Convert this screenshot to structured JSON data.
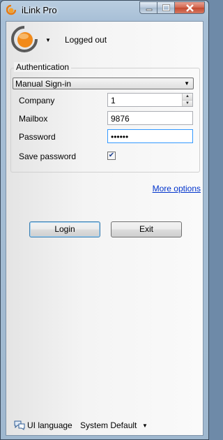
{
  "window": {
    "title": "iLink Pro"
  },
  "status": {
    "text": "Logged out",
    "dropdown_icon": "triangle-down-icon"
  },
  "auth": {
    "group_title": "Authentication",
    "method": "Manual Sign-in",
    "company_label": "Company",
    "company_value": "1",
    "mailbox_label": "Mailbox",
    "mailbox_value": "9876",
    "password_label": "Password",
    "password_value": "••••••",
    "save_password_label": "Save password",
    "save_password_checked": true
  },
  "links": {
    "more_options": "More options"
  },
  "buttons": {
    "login": "Login",
    "exit": "Exit"
  },
  "language": {
    "label": "UI language",
    "value": "System Default"
  },
  "colors": {
    "accent_orange": "#f28a1a",
    "link_blue": "#0033cc",
    "close_red": "#c44a30"
  }
}
